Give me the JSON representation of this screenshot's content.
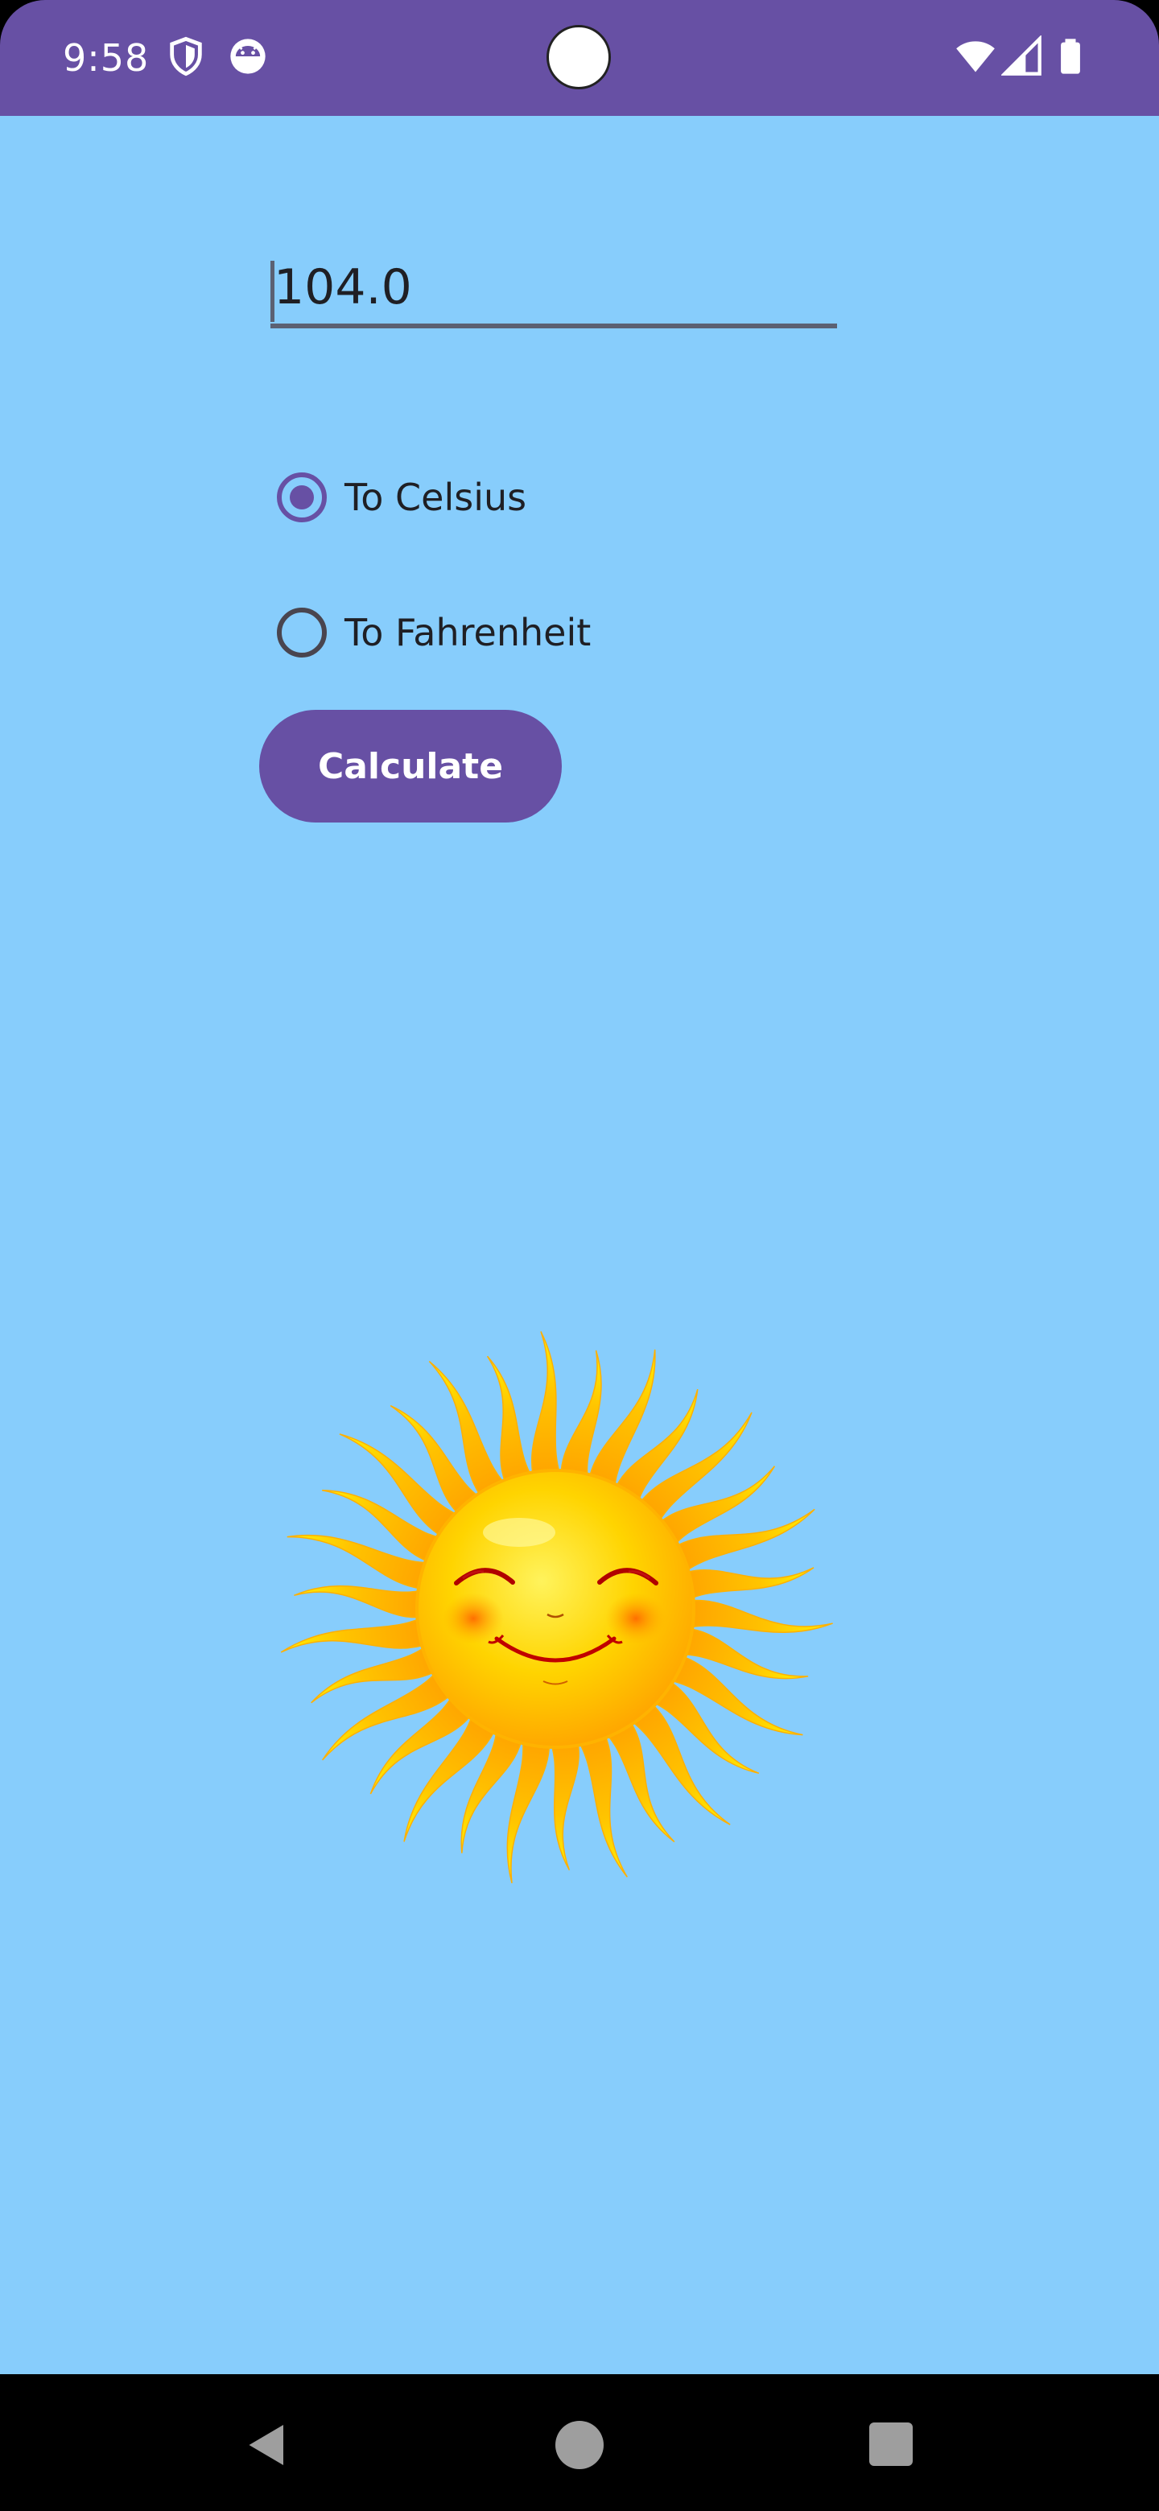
{
  "status_bar": {
    "time": "9:58",
    "icons": [
      "shield-icon",
      "android-face-icon",
      "wifi-icon",
      "cellular-signal-icon",
      "battery-icon"
    ],
    "background_color": "#6750A4"
  },
  "temperature_input": {
    "value": "104.0"
  },
  "conversion_options": [
    {
      "label": "To Celsius",
      "checked": true
    },
    {
      "label": "To Fahrenheit",
      "checked": false
    }
  ],
  "calculate_button": {
    "label": "Calculate"
  },
  "illustration": {
    "icon": "smiling-sun-icon"
  },
  "nav_bar": {
    "icons": [
      "back-icon",
      "home-icon",
      "recents-icon"
    ]
  },
  "colors": {
    "accent": "#6750A4",
    "background": "#87CDFC"
  }
}
